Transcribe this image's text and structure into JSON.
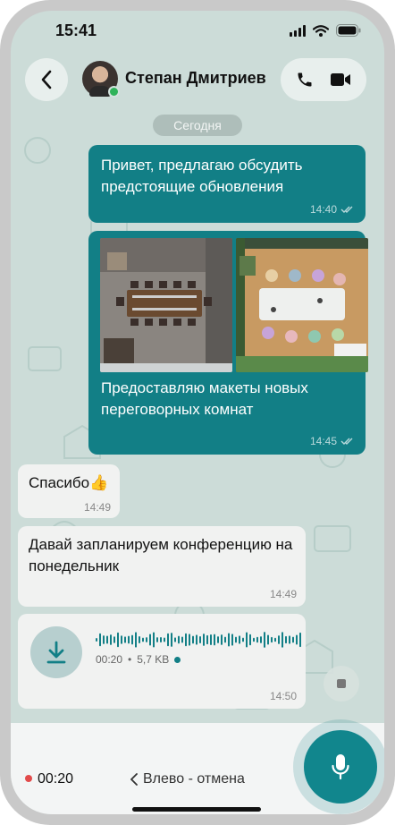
{
  "status_bar": {
    "time": "15:41"
  },
  "header": {
    "contact_name": "Степан Дмитриев"
  },
  "chat": {
    "date_label": "Сегодня",
    "messages": [
      {
        "text": "Привет, предлагаю обсудить предстоящие обновления",
        "time": "14:40"
      },
      {
        "caption": "Предоставляю макеты новых переговорных комнат",
        "time": "14:45"
      },
      {
        "text": "Спасибо👍",
        "time": "14:49"
      },
      {
        "text": "Давай запланируем конференцию на понедельник",
        "time": "14:49"
      },
      {
        "duration": "00:20",
        "size": "5,7 KB",
        "time": "14:50"
      }
    ]
  },
  "recorder": {
    "elapsed": "00:20",
    "cancel_hint": "Влево - отмена"
  },
  "colors": {
    "accent": "#127f86",
    "incoming": "#f1f2f1",
    "chat_bg": "#ccdcd8",
    "record": "#e24b4b"
  },
  "icons": [
    "back-arrow-icon",
    "phone-icon",
    "video-camera-icon",
    "double-check-icon",
    "download-icon",
    "stop-icon",
    "chevron-left-icon",
    "microphone-icon"
  ]
}
